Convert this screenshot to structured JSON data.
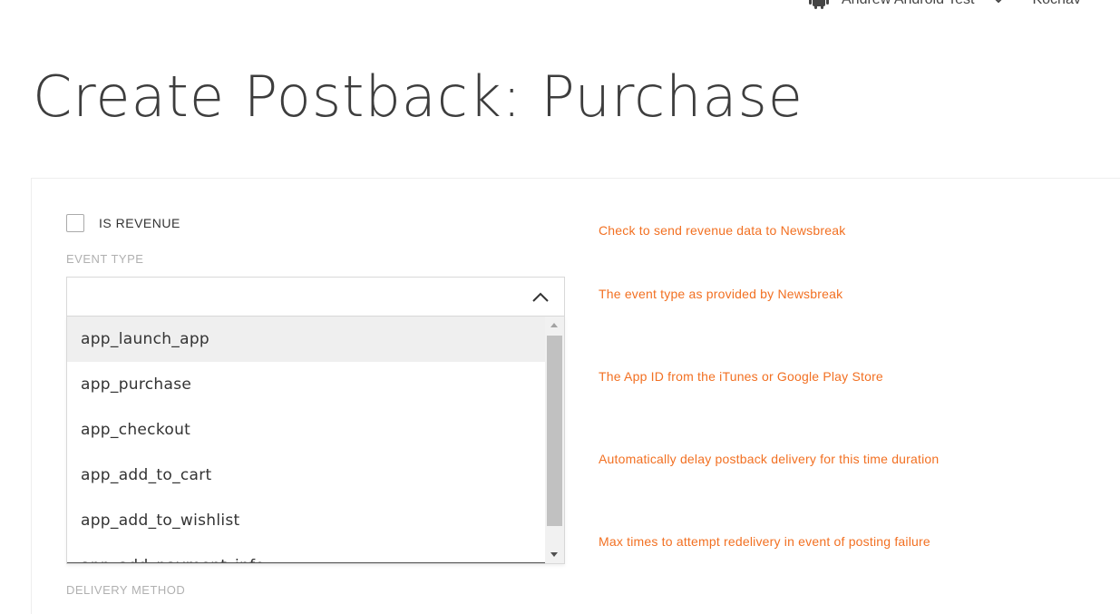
{
  "header": {
    "app_name": "Andrew Android Test",
    "user_name": "Kochav"
  },
  "page": {
    "title": "Create Postback: Purchase"
  },
  "form": {
    "is_revenue": {
      "label": "IS REVENUE",
      "checked": false,
      "hint": "Check to send revenue data to Newsbreak"
    },
    "event_type": {
      "label": "EVENT TYPE",
      "value": "",
      "hint": "The event type as provided by Newsbreak",
      "options": [
        "app_launch_app",
        "app_purchase",
        "app_checkout",
        "app_add_to_cart",
        "app_add_to_wishlist",
        "app_add_payment_info"
      ],
      "hovered_index": 0
    },
    "app_id_hint": "The App ID from the iTunes or Google Play Store",
    "delay_hint": "Automatically delay postback delivery for this time duration",
    "retry_hint": "Max times to attempt redelivery in event of posting failure",
    "delivery_method": {
      "label": "DELIVERY METHOD"
    }
  },
  "colors": {
    "hint": "#f27022",
    "label": "#b0b0b0",
    "hover": "#efefef"
  }
}
